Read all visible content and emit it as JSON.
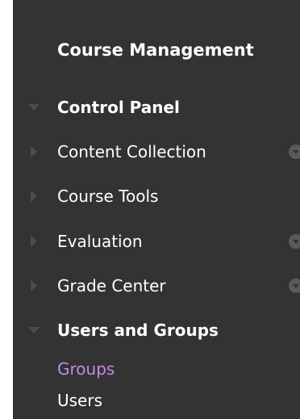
{
  "menu": {
    "title": "Course Management",
    "items": [
      {
        "label": "Control Panel",
        "expanded": true,
        "bold": true,
        "has_menu": false
      },
      {
        "label": "Content Collection",
        "expanded": false,
        "bold": false,
        "has_menu": true
      },
      {
        "label": "Course Tools",
        "expanded": false,
        "bold": false,
        "has_menu": false
      },
      {
        "label": "Evaluation",
        "expanded": false,
        "bold": false,
        "has_menu": true
      },
      {
        "label": "Grade Center",
        "expanded": false,
        "bold": false,
        "has_menu": true
      },
      {
        "label": "Users and Groups",
        "expanded": true,
        "bold": true,
        "has_menu": false
      }
    ],
    "sub_items": [
      {
        "label": "Groups",
        "active": true
      },
      {
        "label": "Users",
        "active": false
      }
    ]
  },
  "colors": {
    "panel_bg": "#333333",
    "text": "#ffffff",
    "arrow": "#4d4d4d",
    "context_button": "#5a5a5a",
    "active_link": "#c58ae2"
  },
  "icons": {
    "expanded": "triangle-down-icon",
    "collapsed": "triangle-right-icon",
    "context_menu": "context-menu-icon"
  }
}
